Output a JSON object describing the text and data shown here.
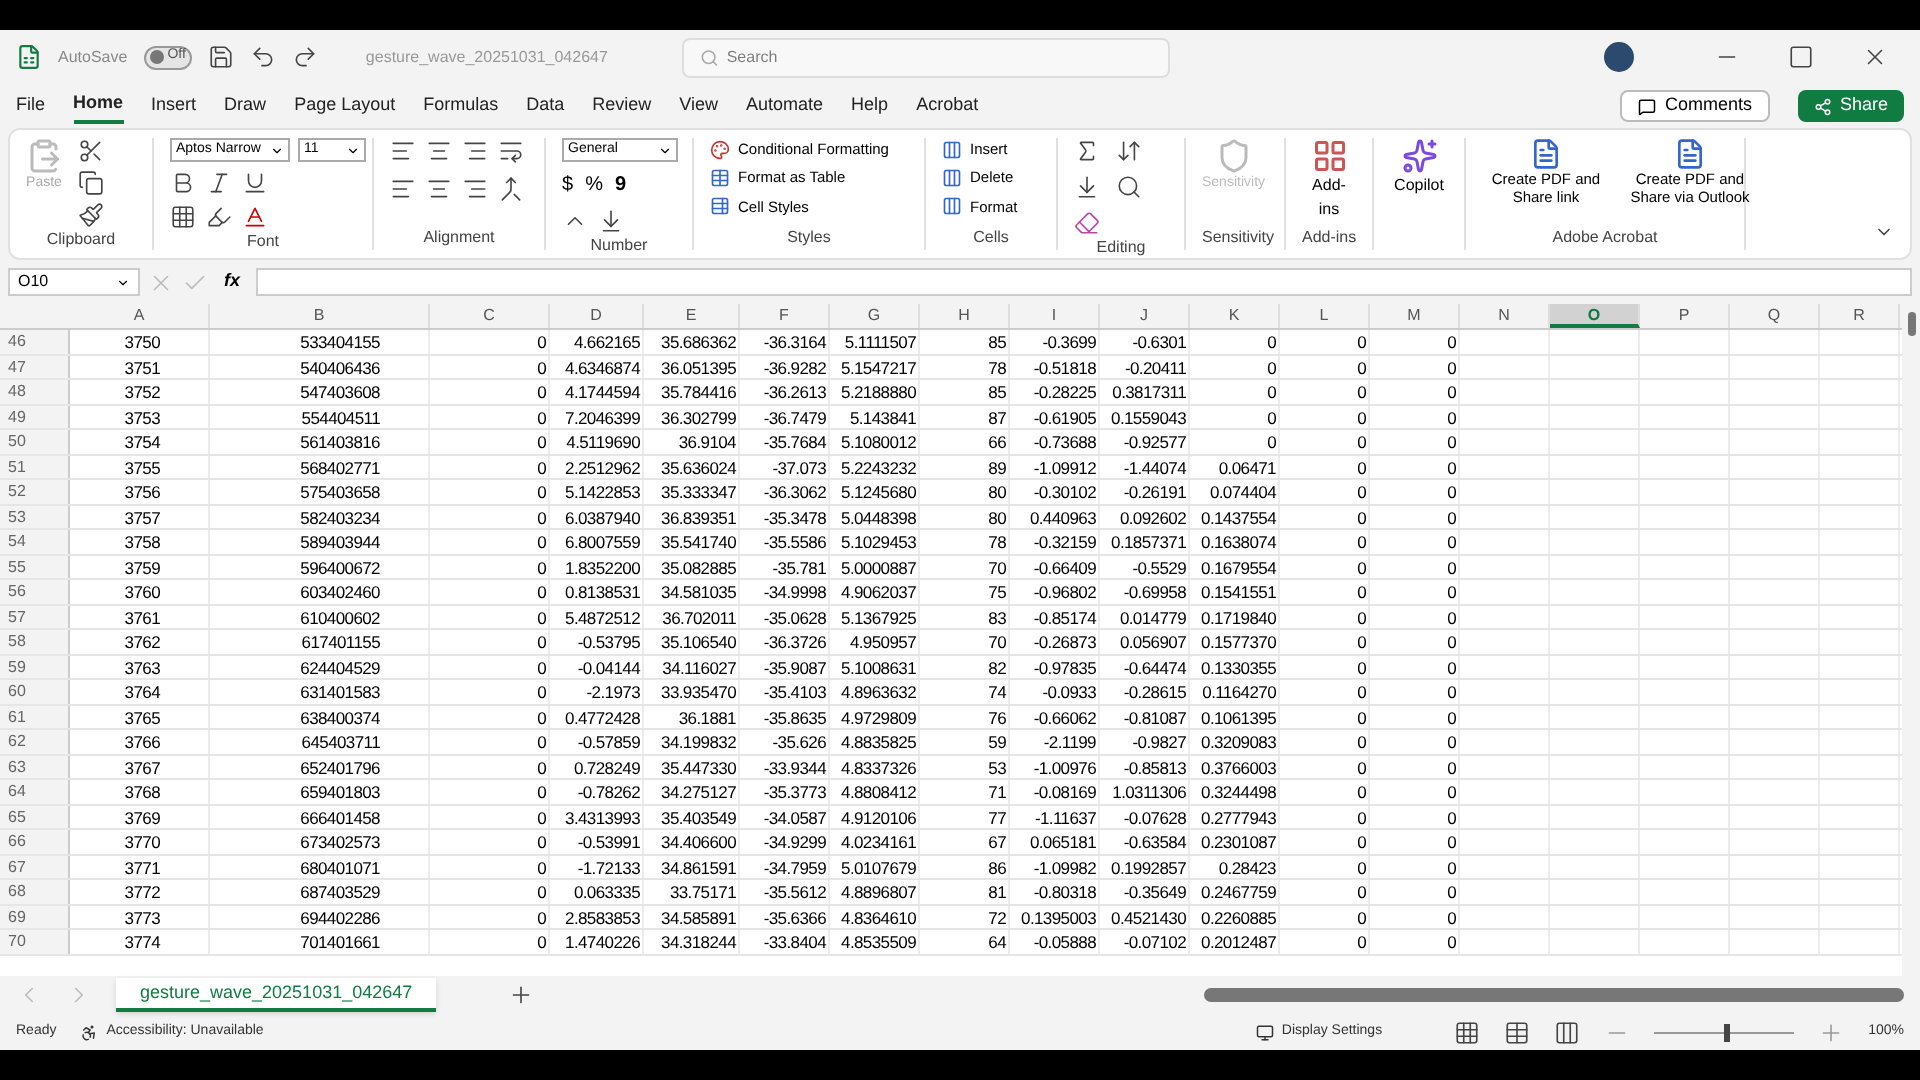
{
  "title_bar": {
    "autosave_label": "AutoSave",
    "autosave_toggle": {
      "label": "Off",
      "on": false
    },
    "filename": "gesture_wave_20251031_042647",
    "search": {
      "placeholder": "Search"
    }
  },
  "menu_tabs": [
    {
      "label": "File",
      "selected": false
    },
    {
      "label": "Home",
      "selected": true
    },
    {
      "label": "Insert",
      "selected": false
    },
    {
      "label": "Draw",
      "selected": false
    },
    {
      "label": "Page Layout",
      "selected": false
    },
    {
      "label": "Formulas",
      "selected": false
    },
    {
      "label": "Data",
      "selected": false
    },
    {
      "label": "Review",
      "selected": false
    },
    {
      "label": "View",
      "selected": false
    },
    {
      "label": "Automate",
      "selected": false
    },
    {
      "label": "Help",
      "selected": false
    },
    {
      "label": "Acrobat",
      "selected": false
    }
  ],
  "comments_button": "Comments",
  "share_button": "Share",
  "ribbon": {
    "clipboard": {
      "paste": "Paste",
      "label": "Clipboard"
    },
    "font": {
      "family": "Aptos Narrow",
      "size": "11",
      "label": "Font"
    },
    "alignment": {
      "label": "Alignment"
    },
    "number": {
      "format": "General",
      "currency": "$",
      "percent": "%",
      "comma": "9",
      "label": "Number"
    },
    "styles": {
      "items": [
        "Conditional Formatting",
        "Format as Table",
        "Cell Styles"
      ],
      "label": "Styles"
    },
    "cells": {
      "items": [
        "Insert",
        "Delete",
        "Format"
      ],
      "label": "Cells"
    },
    "editing": {
      "label": "Editing"
    },
    "sensitivity": {
      "button": "Sensitivity",
      "label": "Sensitivity",
      "disabled": true
    },
    "addins": {
      "button": "Add-ins",
      "label": "Add-ins"
    },
    "copilot": {
      "button": "Copilot"
    },
    "acrobat": {
      "buttons": [
        "Create PDF and Share link",
        "Create PDF and Share via Outlook"
      ],
      "label": "Adobe Acrobat"
    }
  },
  "formula_bar": {
    "name_box": "O10",
    "fx": "fx"
  },
  "columns": [
    {
      "label": "A",
      "selected": false
    },
    {
      "label": "B",
      "selected": false
    },
    {
      "label": "C",
      "selected": false
    },
    {
      "label": "D",
      "selected": false
    },
    {
      "label": "E",
      "selected": false
    },
    {
      "label": "F",
      "selected": false
    },
    {
      "label": "G",
      "selected": false
    },
    {
      "label": "H",
      "selected": false
    },
    {
      "label": "I",
      "selected": false
    },
    {
      "label": "J",
      "selected": false
    },
    {
      "label": "K",
      "selected": false
    },
    {
      "label": "L",
      "selected": false
    },
    {
      "label": "M",
      "selected": false
    },
    {
      "label": "N",
      "selected": false
    },
    {
      "label": "O",
      "selected": true
    },
    {
      "label": "P",
      "selected": false
    },
    {
      "label": "Q",
      "selected": false
    },
    {
      "label": "R",
      "selected": false
    }
  ],
  "rows": [
    {
      "number": "46",
      "cells": [
        "3750",
        "533404155",
        "0",
        "4.662165",
        "35.686362",
        "-36.3164",
        "5.1111507",
        "85",
        "-0.3699",
        "-0.6301",
        "0",
        "0",
        "0"
      ]
    },
    {
      "number": "47",
      "cells": [
        "3751",
        "540406436",
        "0",
        "4.6346874",
        "36.051395",
        "-36.9282",
        "5.1547217",
        "78",
        "-0.51818",
        "-0.20411",
        "0",
        "0",
        "0"
      ]
    },
    {
      "number": "48",
      "cells": [
        "3752",
        "547403608",
        "0",
        "4.1744594",
        "35.784416",
        "-36.2613",
        "5.2188880",
        "85",
        "-0.28225",
        "0.3817311",
        "0",
        "0",
        "0"
      ]
    },
    {
      "number": "49",
      "cells": [
        "3753",
        "554404511",
        "0",
        "7.2046399",
        "36.302799",
        "-36.7479",
        "5.143841",
        "87",
        "-0.61905",
        "0.1559043",
        "0",
        "0",
        "0"
      ]
    },
    {
      "number": "50",
      "cells": [
        "3754",
        "561403816",
        "0",
        "4.5119690",
        "36.9104",
        "-35.7684",
        "5.1080012",
        "66",
        "-0.73688",
        "-0.92577",
        "0",
        "0",
        "0"
      ]
    },
    {
      "number": "51",
      "cells": [
        "3755",
        "568402771",
        "0",
        "2.2512962",
        "35.636024",
        "-37.073",
        "5.2243232",
        "89",
        "-1.09912",
        "-1.44074",
        "0.06471",
        "0",
        "0"
      ]
    },
    {
      "number": "52",
      "cells": [
        "3756",
        "575403658",
        "0",
        "5.1422853",
        "35.333347",
        "-36.3062",
        "5.1245680",
        "80",
        "-0.30102",
        "-0.26191",
        "0.074404",
        "0",
        "0"
      ]
    },
    {
      "number": "53",
      "cells": [
        "3757",
        "582403234",
        "0",
        "6.0387940",
        "36.839351",
        "-35.3478",
        "5.0448398",
        "80",
        "0.440963",
        "0.092602",
        "0.1437554",
        "0",
        "0"
      ]
    },
    {
      "number": "54",
      "cells": [
        "3758",
        "589403944",
        "0",
        "6.8007559",
        "35.541740",
        "-35.5586",
        "5.1029453",
        "78",
        "-0.32159",
        "0.1857371",
        "0.1638074",
        "0",
        "0"
      ]
    },
    {
      "number": "55",
      "cells": [
        "3759",
        "596400672",
        "0",
        "1.8352200",
        "35.082885",
        "-35.781",
        "5.0000887",
        "70",
        "-0.66409",
        "-0.5529",
        "0.1679554",
        "0",
        "0"
      ]
    },
    {
      "number": "56",
      "cells": [
        "3760",
        "603402460",
        "0",
        "0.8138531",
        "34.581035",
        "-34.9998",
        "4.9062037",
        "75",
        "-0.96802",
        "-0.69958",
        "0.1541551",
        "0",
        "0"
      ]
    },
    {
      "number": "57",
      "cells": [
        "3761",
        "610400602",
        "0",
        "5.4872512",
        "36.702011",
        "-35.0628",
        "5.1367925",
        "83",
        "-0.85174",
        "0.014779",
        "0.1719840",
        "0",
        "0"
      ]
    },
    {
      "number": "58",
      "cells": [
        "3762",
        "617401155",
        "0",
        "-0.53795",
        "35.106540",
        "-36.3726",
        "4.950957",
        "70",
        "-0.26873",
        "0.056907",
        "0.1577370",
        "0",
        "0"
      ]
    },
    {
      "number": "59",
      "cells": [
        "3763",
        "624404529",
        "0",
        "-0.04144",
        "34.116027",
        "-35.9087",
        "5.1008631",
        "82",
        "-0.97835",
        "-0.64474",
        "0.1330355",
        "0",
        "0"
      ]
    },
    {
      "number": "60",
      "cells": [
        "3764",
        "631401583",
        "0",
        "-2.1973",
        "33.935470",
        "-35.4103",
        "4.8963632",
        "74",
        "-0.0933",
        "-0.28615",
        "0.1164270",
        "0",
        "0"
      ]
    },
    {
      "number": "61",
      "cells": [
        "3765",
        "638400374",
        "0",
        "0.4772428",
        "36.1881",
        "-35.8635",
        "4.9729809",
        "76",
        "-0.66062",
        "-0.81087",
        "0.1061395",
        "0",
        "0"
      ]
    },
    {
      "number": "62",
      "cells": [
        "3766",
        "645403711",
        "0",
        "-0.57859",
        "34.199832",
        "-35.626",
        "4.8835825",
        "59",
        "-2.1199",
        "-0.9827",
        "0.3209083",
        "0",
        "0"
      ]
    },
    {
      "number": "63",
      "cells": [
        "3767",
        "652401796",
        "0",
        "0.728249",
        "35.447330",
        "-33.9344",
        "4.8337326",
        "53",
        "-1.00976",
        "-0.85813",
        "0.3766003",
        "0",
        "0"
      ]
    },
    {
      "number": "64",
      "cells": [
        "3768",
        "659401803",
        "0",
        "-0.78262",
        "34.275127",
        "-35.3773",
        "4.8808412",
        "71",
        "-0.08169",
        "1.0311306",
        "0.3244498",
        "0",
        "0"
      ]
    },
    {
      "number": "65",
      "cells": [
        "3769",
        "666401458",
        "0",
        "3.4313993",
        "35.403549",
        "-34.0587",
        "4.9120106",
        "77",
        "-1.11637",
        "-0.07628",
        "0.2777943",
        "0",
        "0"
      ]
    },
    {
      "number": "66",
      "cells": [
        "3770",
        "673402573",
        "0",
        "-0.53991",
        "34.406600",
        "-34.9299",
        "4.0234161",
        "67",
        "0.065181",
        "-0.63584",
        "0.2301087",
        "0",
        "0"
      ]
    },
    {
      "number": "67",
      "cells": [
        "3771",
        "680401071",
        "0",
        "-1.72133",
        "34.861591",
        "-34.7959",
        "5.0107679",
        "86",
        "-1.09982",
        "0.1992857",
        "0.28423",
        "0",
        "0"
      ]
    },
    {
      "number": "68",
      "cells": [
        "3772",
        "687403529",
        "0",
        "0.063335",
        "33.75171",
        "-35.5612",
        "4.8896807",
        "81",
        "-0.80318",
        "-0.35649",
        "0.2467759",
        "0",
        "0"
      ]
    },
    {
      "number": "69",
      "cells": [
        "3773",
        "694402286",
        "0",
        "2.8583853",
        "34.585891",
        "-35.6366",
        "4.8364610",
        "72",
        "0.1395003",
        "0.4521430",
        "0.2260885",
        "0",
        "0"
      ]
    },
    {
      "number": "70",
      "cells": [
        "3774",
        "701401661",
        "0",
        "1.4740226",
        "34.318244",
        "-33.8404",
        "4.8535509",
        "64",
        "-0.05888",
        "-0.07102",
        "0.2012487",
        "0",
        "0"
      ]
    }
  ],
  "sheet_tabs": [
    {
      "label": "gesture_wave_20251031_042647",
      "selected": true
    }
  ],
  "status_bar": {
    "ready": "Ready",
    "accessibility": "Accessibility: Unavailable",
    "display_settings": "Display Settings",
    "zoom": {
      "level": 0.5,
      "reading": "100%"
    }
  }
}
